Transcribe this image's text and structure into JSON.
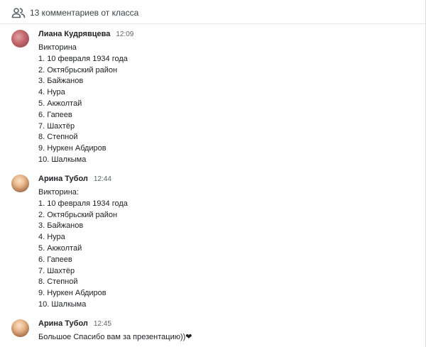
{
  "header": {
    "people_icon": "people-icon",
    "title": "13 комментариев от класса"
  },
  "comments": [
    {
      "author": "Лиана Кудрявцева",
      "time": "12:09",
      "lines": [
        "Викторина",
        "1. 10 февраля 1934 года",
        "2. Октябрьский район",
        "3. Байжанов",
        "4. Нура",
        "5. Акжолтай",
        "6. Гапеев",
        "7. Шахтёр",
        "8. Степной",
        "9. Нуркен Абдиров",
        "10. Шалкыма"
      ]
    },
    {
      "author": "Арина Тубол",
      "time": "12:44",
      "lines": [
        "Викторина:",
        "1. 10 февраля 1934 года",
        "2. Октябрьский район",
        "3. Байжанов",
        "4. Нура",
        "5. Акжолтай",
        "6. Гапеев",
        "7. Шахтёр",
        "8. Степной",
        "9. Нуркен Абдиров",
        "10. Шалкыма"
      ]
    },
    {
      "author": "Арина Тубол",
      "time": "12:45",
      "lines": [
        "Большое Спасибо вам за презентацию))"
      ],
      "suffix": "❤"
    }
  ]
}
